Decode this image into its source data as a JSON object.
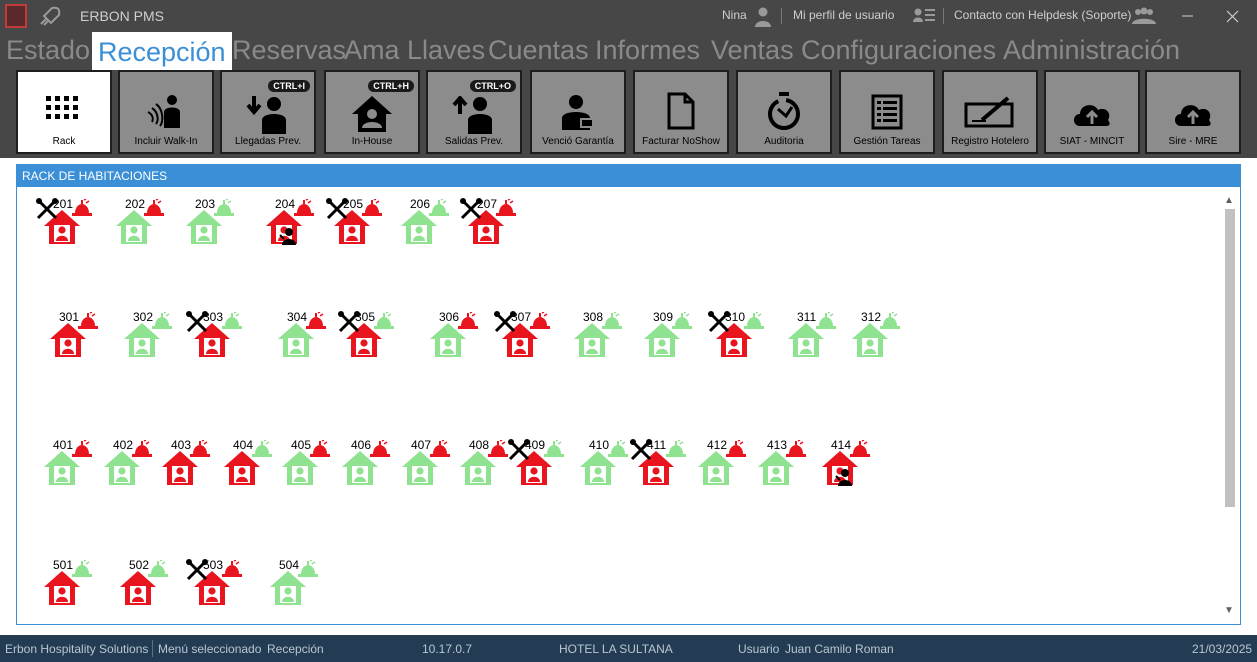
{
  "window": {
    "title": "ERBON PMS",
    "user_name": "Nina",
    "profile_link": "Mi perfil de usuario",
    "helpdesk_link": "Contacto con Helpdesk (Soporte)"
  },
  "menu": {
    "items": [
      "Estado",
      "Recepción",
      "Reservas",
      "Ama Llaves",
      "Cuentas",
      "Informes",
      "Ventas",
      "Configuraciones",
      "Administración"
    ],
    "active": "Recepción"
  },
  "toolbar": {
    "buttons": [
      {
        "label": "Rack",
        "icon": "grid-icon",
        "shortcut": ""
      },
      {
        "label": "Incluir Walk-In",
        "icon": "walk-in-icon",
        "shortcut": ""
      },
      {
        "label": "Llegadas Prev.",
        "icon": "arrival-icon",
        "shortcut": "CTRL+I"
      },
      {
        "label": "In-House",
        "icon": "house-icon",
        "shortcut": "CTRL+H"
      },
      {
        "label": "Salidas Prev.",
        "icon": "departure-icon",
        "shortcut": "CTRL+O"
      },
      {
        "label": "Venció Garantía",
        "icon": "guarantee-icon",
        "shortcut": ""
      },
      {
        "label": "Facturar NoShow",
        "icon": "document-icon",
        "shortcut": ""
      },
      {
        "label": "Auditoria",
        "icon": "timer-icon",
        "shortcut": ""
      },
      {
        "label": "Gestión Tareas",
        "icon": "task-list-icon",
        "shortcut": ""
      },
      {
        "label": "Registro Hotelero",
        "icon": "signature-icon",
        "shortcut": ""
      },
      {
        "label": "SIAT - MINCIT",
        "icon": "cloud-upload-icon",
        "shortcut": ""
      },
      {
        "label": "Sire - MRE",
        "icon": "cloud-upload-icon",
        "shortcut": ""
      }
    ]
  },
  "rack": {
    "title": "RACK DE HABITACIONES",
    "colors": {
      "occupied": "#e8141e",
      "vacant": "#8fe28f",
      "bell_dirty": "#e8141e",
      "bell_clean": "#8fe28f"
    },
    "floors": [
      {
        "rooms": [
          {
            "number": "201",
            "status": "occupied",
            "bell": "dirty",
            "maintenance": true,
            "guest": false
          },
          {
            "number": "202",
            "status": "vacant",
            "bell": "dirty",
            "maintenance": false,
            "guest": false
          },
          {
            "number": "203",
            "status": "vacant",
            "bell": "clean",
            "maintenance": false,
            "guest": false
          },
          {
            "number": "204",
            "status": "occupied",
            "bell": "dirty",
            "maintenance": false,
            "guest": true
          },
          {
            "number": "205",
            "status": "occupied",
            "bell": "dirty",
            "maintenance": true,
            "guest": false
          },
          {
            "number": "206",
            "status": "vacant",
            "bell": "clean",
            "maintenance": false,
            "guest": false
          },
          {
            "number": "207",
            "status": "occupied",
            "bell": "dirty",
            "maintenance": true,
            "guest": false
          }
        ]
      },
      {
        "rooms": [
          {
            "number": "301",
            "status": "occupied",
            "bell": "dirty",
            "maintenance": false,
            "guest": false
          },
          {
            "number": "302",
            "status": "vacant",
            "bell": "clean",
            "maintenance": false,
            "guest": false
          },
          {
            "number": "303",
            "status": "occupied",
            "bell": "clean",
            "maintenance": true,
            "guest": false
          },
          {
            "number": "304",
            "status": "vacant",
            "bell": "dirty",
            "maintenance": false,
            "guest": false
          },
          {
            "number": "305",
            "status": "occupied",
            "bell": "clean",
            "maintenance": true,
            "guest": false
          },
          {
            "number": "306",
            "status": "vacant",
            "bell": "dirty",
            "maintenance": false,
            "guest": false
          },
          {
            "number": "307",
            "status": "occupied",
            "bell": "dirty",
            "maintenance": true,
            "guest": false
          },
          {
            "number": "308",
            "status": "vacant",
            "bell": "clean",
            "maintenance": false,
            "guest": false
          },
          {
            "number": "309",
            "status": "vacant",
            "bell": "clean",
            "maintenance": false,
            "guest": false
          },
          {
            "number": "310",
            "status": "occupied",
            "bell": "clean",
            "maintenance": true,
            "guest": false
          },
          {
            "number": "311",
            "status": "vacant",
            "bell": "clean",
            "maintenance": false,
            "guest": false
          },
          {
            "number": "312",
            "status": "vacant",
            "bell": "clean",
            "maintenance": false,
            "guest": false
          }
        ]
      },
      {
        "rooms": [
          {
            "number": "401",
            "status": "vacant",
            "bell": "dirty",
            "maintenance": false,
            "guest": false
          },
          {
            "number": "402",
            "status": "vacant",
            "bell": "dirty",
            "maintenance": false,
            "guest": false
          },
          {
            "number": "403",
            "status": "occupied",
            "bell": "dirty",
            "maintenance": false,
            "guest": false
          },
          {
            "number": "404",
            "status": "occupied",
            "bell": "clean",
            "maintenance": false,
            "guest": false
          },
          {
            "number": "405",
            "status": "vacant",
            "bell": "dirty",
            "maintenance": false,
            "guest": false
          },
          {
            "number": "406",
            "status": "vacant",
            "bell": "dirty",
            "maintenance": false,
            "guest": false
          },
          {
            "number": "407",
            "status": "vacant",
            "bell": "dirty",
            "maintenance": false,
            "guest": false
          },
          {
            "number": "408",
            "status": "vacant",
            "bell": "dirty",
            "maintenance": false,
            "guest": false
          },
          {
            "number": "409",
            "status": "occupied",
            "bell": "clean",
            "maintenance": true,
            "guest": false
          },
          {
            "number": "410",
            "status": "vacant",
            "bell": "clean",
            "maintenance": false,
            "guest": false
          },
          {
            "number": "411",
            "status": "occupied",
            "bell": "clean",
            "maintenance": true,
            "guest": false
          },
          {
            "number": "412",
            "status": "vacant",
            "bell": "dirty",
            "maintenance": false,
            "guest": false
          },
          {
            "number": "413",
            "status": "vacant",
            "bell": "dirty",
            "maintenance": false,
            "guest": false
          },
          {
            "number": "414",
            "status": "occupied",
            "bell": "dirty",
            "maintenance": false,
            "guest": true
          }
        ]
      },
      {
        "rooms": [
          {
            "number": "501",
            "status": "occupied",
            "bell": "clean",
            "maintenance": false,
            "guest": false
          },
          {
            "number": "502",
            "status": "occupied",
            "bell": "clean",
            "maintenance": false,
            "guest": false
          },
          {
            "number": "503",
            "status": "occupied",
            "bell": "dirty",
            "maintenance": true,
            "guest": false
          },
          {
            "number": "504",
            "status": "vacant",
            "bell": "clean",
            "maintenance": false,
            "guest": false
          }
        ]
      }
    ]
  },
  "statusbar": {
    "company": "Erbon Hospitality Solutions",
    "menu_label": "Menú seleccionado",
    "menu_value": "Recepción",
    "version": "10.17.0.7",
    "hotel": "HOTEL LA SULTANA",
    "user_label": "Usuario",
    "user_value": "Juan Camilo Roman",
    "date": "21/03/2025"
  }
}
